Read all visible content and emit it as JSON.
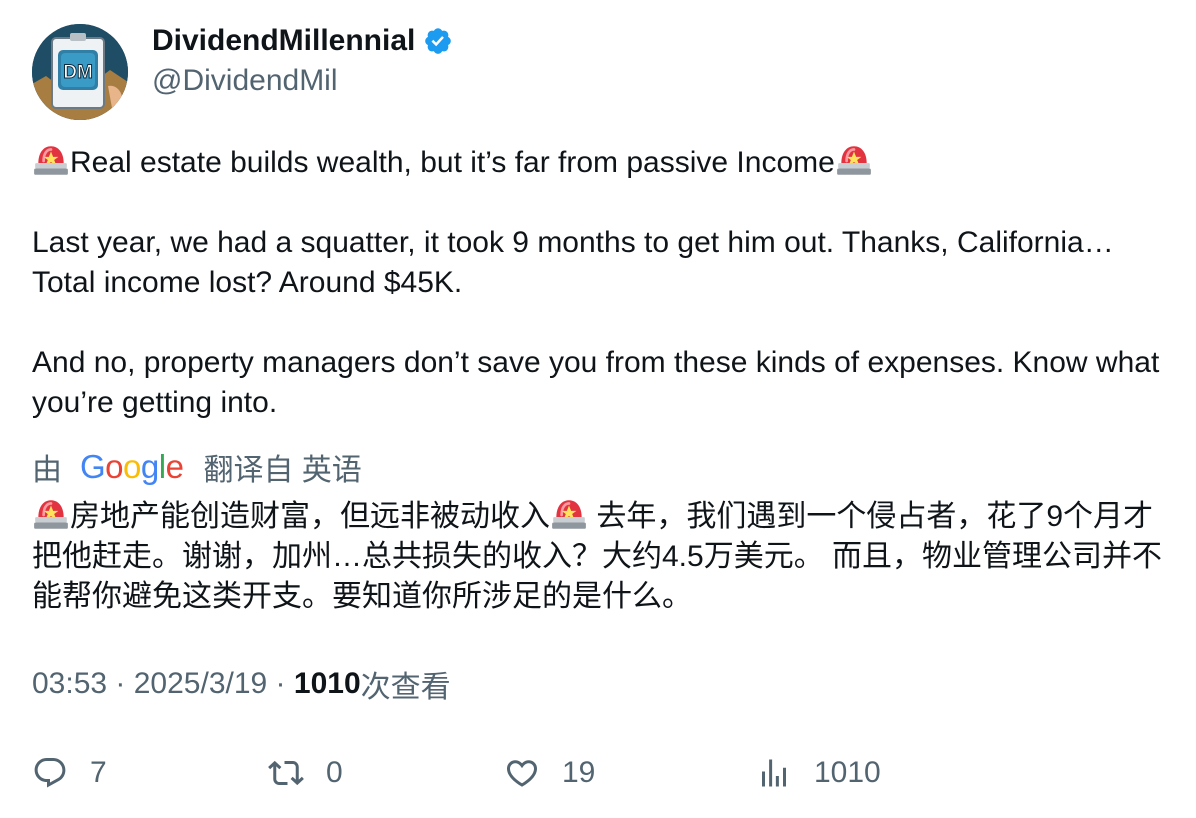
{
  "author": {
    "display_name": "DividendMillennial",
    "handle": "@DividendMil",
    "avatar_text": "DM"
  },
  "tweet": {
    "paragraphs": [
      "Real estate builds wealth, but it’s far from passive Income",
      "Last year, we had a squatter, it took 9 months to get him out. Thanks, California… Total income lost? Around $45K.",
      "And no, property managers don’t save you from these kinds of expenses. Know what you’re getting into."
    ]
  },
  "translation": {
    "prefix": "由",
    "provider": "Google",
    "suffix": "翻译自 英语",
    "text_part1": "房地产能创造财富，但远非被动收入",
    "text_part2": " 去年，我们遇到一个侵占者，花了9个月才把他赶走。谢谢，加州…总共损失的收入？大约4.5万美元。 而且，物业管理公司并不能帮你避免这类开支。要知道你所涉足的是什么。"
  },
  "meta": {
    "time": "03:53",
    "separator": " · ",
    "date": "2025/3/19",
    "views_count": "1010",
    "views_label": "次查看"
  },
  "actions": {
    "replies": "7",
    "reposts": "0",
    "likes": "19",
    "views": "1010"
  },
  "colors": {
    "text_primary": "#0f1419",
    "text_secondary": "#536471",
    "verified_blue": "#1d9bf0"
  }
}
